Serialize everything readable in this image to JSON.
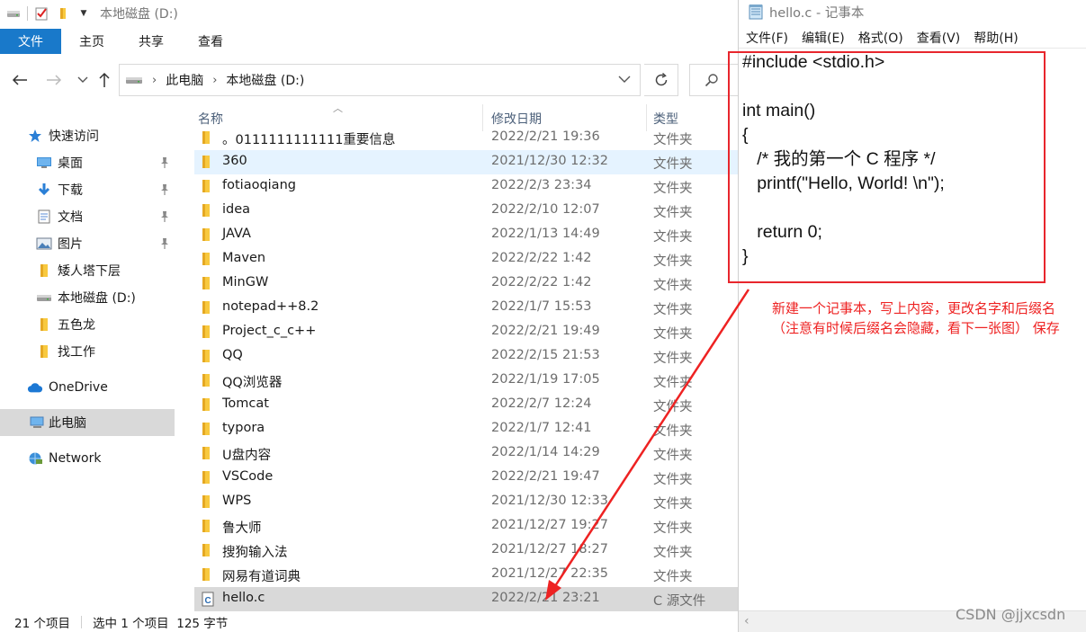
{
  "explorer": {
    "title": "本地磁盘 (D:)",
    "ribbon_tabs": [
      {
        "label": "文件",
        "active": true
      },
      {
        "label": "主页"
      },
      {
        "label": "共享"
      },
      {
        "label": "查看"
      }
    ],
    "address": {
      "seg1": "此电脑",
      "seg2": "本地磁盘 (D:)"
    },
    "nav_items": [
      {
        "label": "快速访问",
        "icon": "star-icon",
        "pinned": false
      },
      {
        "label": "桌面",
        "icon": "desktop-icon",
        "pinned": true
      },
      {
        "label": "下载",
        "icon": "download-icon",
        "pinned": true
      },
      {
        "label": "文档",
        "icon": "document-icon",
        "pinned": true
      },
      {
        "label": "图片",
        "icon": "picture-icon",
        "pinned": true
      },
      {
        "label": "矮人塔下层",
        "icon": "folder-icon",
        "pinned": false
      },
      {
        "label": "本地磁盘 (D:)",
        "icon": "drive-icon",
        "pinned": false
      },
      {
        "label": "五色龙",
        "icon": "folder-icon",
        "pinned": false
      },
      {
        "label": "找工作",
        "icon": "folder-icon",
        "pinned": false
      },
      {
        "label": "OneDrive",
        "icon": "cloud-icon",
        "pinned": false
      },
      {
        "label": "此电脑",
        "icon": "computer-icon",
        "pinned": false,
        "selected": true
      },
      {
        "label": "Network",
        "icon": "network-icon",
        "pinned": false
      }
    ],
    "columns": {
      "name": "名称",
      "date": "修改日期",
      "type": "类型"
    },
    "files": [
      {
        "name": "。0111111111111重要信息",
        "date": "2022/2/21 19:36",
        "type": "文件夹"
      },
      {
        "name": "360",
        "date": "2021/12/30 12:32",
        "type": "文件夹",
        "highlight": true
      },
      {
        "name": "fotiaoqiang",
        "date": "2022/2/3 23:34",
        "type": "文件夹"
      },
      {
        "name": "idea",
        "date": "2022/2/10 12:07",
        "type": "文件夹"
      },
      {
        "name": "JAVA",
        "date": "2022/1/13 14:49",
        "type": "文件夹"
      },
      {
        "name": "Maven",
        "date": "2022/2/22 1:42",
        "type": "文件夹"
      },
      {
        "name": "MinGW",
        "date": "2022/2/22 1:42",
        "type": "文件夹"
      },
      {
        "name": "notepad++8.2",
        "date": "2022/1/7 15:53",
        "type": "文件夹"
      },
      {
        "name": "Project_c_c++",
        "date": "2022/2/21 19:49",
        "type": "文件夹"
      },
      {
        "name": "QQ",
        "date": "2022/2/15 21:53",
        "type": "文件夹"
      },
      {
        "name": "QQ浏览器",
        "date": "2022/1/19 17:05",
        "type": "文件夹"
      },
      {
        "name": "Tomcat",
        "date": "2022/2/7 12:24",
        "type": "文件夹"
      },
      {
        "name": "typora",
        "date": "2022/1/7 12:41",
        "type": "文件夹"
      },
      {
        "name": "U盘内容",
        "date": "2022/1/14 14:29",
        "type": "文件夹"
      },
      {
        "name": "VSCode",
        "date": "2022/2/21 19:47",
        "type": "文件夹"
      },
      {
        "name": "WPS",
        "date": "2021/12/30 12:33",
        "type": "文件夹"
      },
      {
        "name": "鲁大师",
        "date": "2021/12/27 19:27",
        "type": "文件夹"
      },
      {
        "name": "搜狗输入法",
        "date": "2021/12/27 18:27",
        "type": "文件夹"
      },
      {
        "name": "网易有道词典",
        "date": "2021/12/27 22:35",
        "type": "文件夹"
      },
      {
        "name": "hello.c",
        "date": "2022/2/21 23:21",
        "type": "C 源文件",
        "selected": true,
        "icon": "c-file-icon"
      }
    ],
    "status": {
      "count": "21 个项目",
      "selected": "选中 1 个项目  125 字节"
    }
  },
  "notepad": {
    "title": "hello.c - 记事本",
    "menu": [
      "文件(F)",
      "编辑(E)",
      "格式(O)",
      "查看(V)",
      "帮助(H)"
    ],
    "content": "#include <stdio.h>\n\nint main()\n{\n   /* 我的第一个 C 程序 */\n   printf(\"Hello, World! \\n\");\n\n   return 0;\n}"
  },
  "annotation": {
    "text": "新建一个记事本，写上内容，更改名字和后缀名（注意有时候后缀名会隐藏，看下一张图） 保存",
    "color": "#ee2222"
  },
  "watermark": "CSDN @jjxcsdn",
  "colors": {
    "accent": "#1979ca",
    "selection": "#d9d9d9",
    "hover": "#e5f3ff",
    "folder": "#f8c93f",
    "annotation_red": "#e8262d"
  }
}
